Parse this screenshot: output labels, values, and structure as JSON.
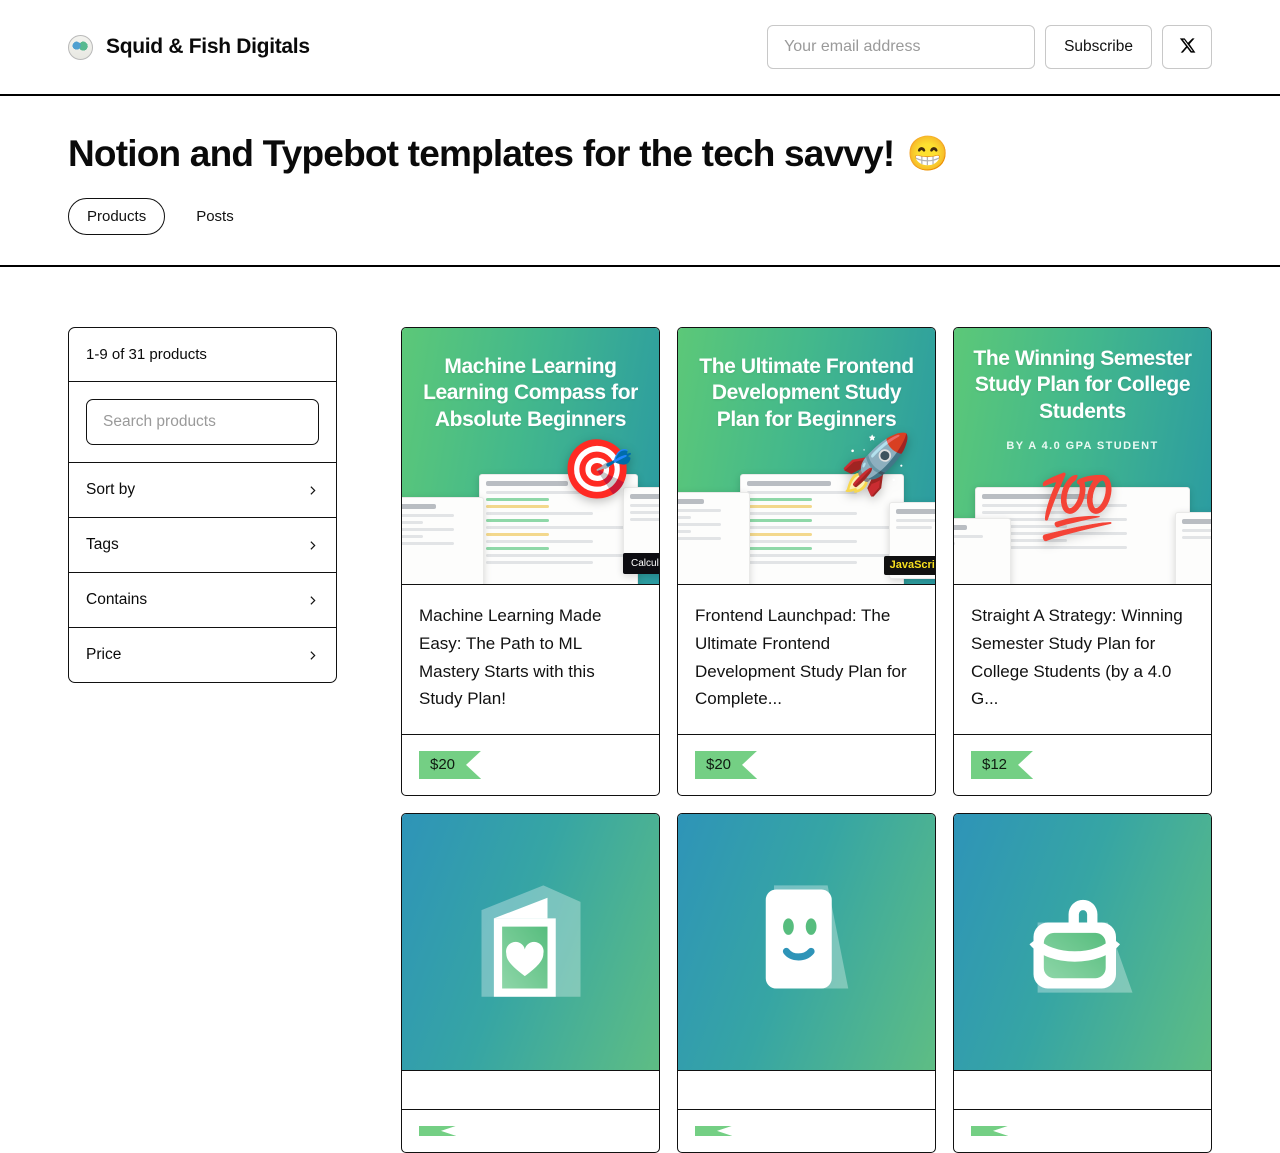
{
  "header": {
    "brand_name": "Squid & Fish Digitals",
    "logo_icon": "squid-fish-avatar",
    "email_placeholder": "Your email address",
    "email_value": "",
    "subscribe_label": "Subscribe",
    "x_icon": "x-twitter-icon"
  },
  "page": {
    "title": "Notion and Typebot templates for the tech savvy!",
    "title_emoji": "😁",
    "tabs": [
      {
        "label": "Products",
        "active": true
      },
      {
        "label": "Posts",
        "active": false
      }
    ]
  },
  "sidebar": {
    "count_label": "1-9 of 31 products",
    "search_placeholder": "Search products",
    "search_value": "",
    "filters": [
      {
        "label": "Sort by",
        "icon": "chevron-right-icon"
      },
      {
        "label": "Tags",
        "icon": "chevron-right-icon"
      },
      {
        "label": "Contains",
        "icon": "chevron-right-icon"
      },
      {
        "label": "Price",
        "icon": "chevron-right-icon"
      }
    ]
  },
  "products": [
    {
      "title": "Machine Learning Made Easy: The Path to ML Mastery Starts with this Study Plan!",
      "price": "$20",
      "cover_type": "artwork",
      "cover_title": "Machine Learning Learning Compass for Absolute Beginners",
      "cover_sub": "",
      "cover_emblem": "🎯",
      "cover_badge": "Calculus"
    },
    {
      "title": "Frontend Launchpad: The Ultimate Frontend Development Study Plan for Complete...",
      "price": "$20",
      "cover_type": "artwork",
      "cover_title": "The Ultimate Frontend Development Study Plan for Beginners",
      "cover_sub": "",
      "cover_emblem": "🚀",
      "cover_badge": "JavaScript"
    },
    {
      "title": "Straight A Strategy: Winning Semester Study Plan for College Students (by a 4.0 G...",
      "price": "$12",
      "cover_type": "artwork",
      "cover_title": "The Winning Semester Study Plan for College Students",
      "cover_sub": "BY A 4.0 GPA STUDENT",
      "cover_emblem": "💯",
      "cover_badge": ""
    },
    {
      "title": "",
      "price": "",
      "cover_type": "placeholder",
      "cover_icon": "card-heart-icon"
    },
    {
      "title": "",
      "price": "",
      "cover_type": "placeholder",
      "cover_icon": "smiley-note-icon"
    },
    {
      "title": "",
      "price": "",
      "cover_type": "placeholder",
      "cover_icon": "briefcase-icon"
    }
  ],
  "colors": {
    "cover_green": "#5cc878",
    "cover_teal": "#2a9aa2",
    "price_green": "#74cf84",
    "border": "#111111"
  }
}
